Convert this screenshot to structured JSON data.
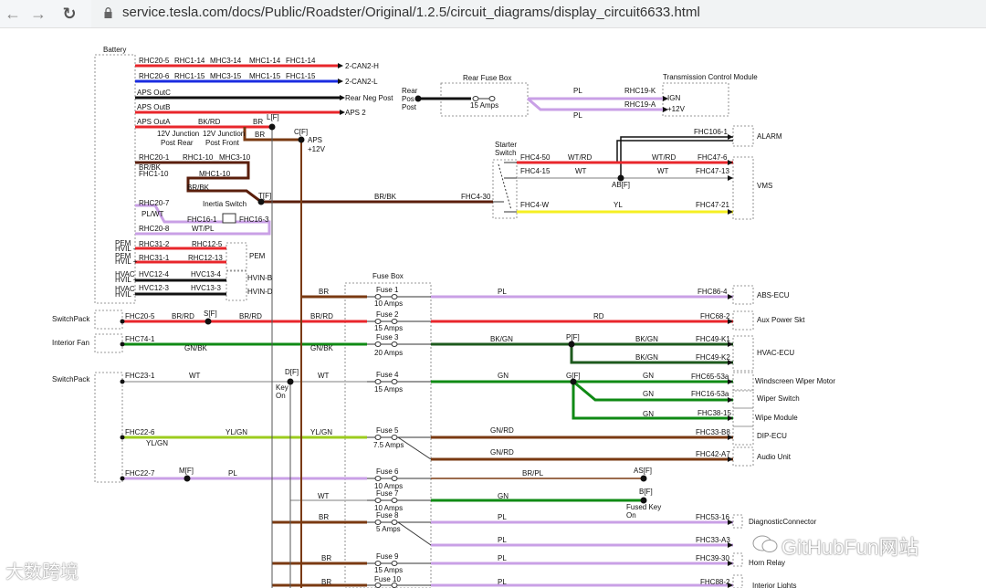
{
  "browser": {
    "back": "←",
    "forward": "→",
    "reload": "↻",
    "url": "service.tesla.com/docs/Public/Roadster/Original/1.2.5/circuit_diagrams/display_circuit6633.html"
  },
  "watermarks": {
    "left": "大数跨境",
    "right": "GitHubFun网站"
  },
  "colors": {
    "red": "#e8262b",
    "blue": "#1a2ce0",
    "black": "#111111",
    "brown": "#7a3a12",
    "purple": "#c9a0e6",
    "green": "#0f8a14",
    "dark_green": "#1d5a1d",
    "yellow_green": "#9ccc1e",
    "yellow": "#f5ef22",
    "gray": "#8a8a8a"
  },
  "labels": {
    "battery": "Battery",
    "rhc20_5": "RHC20-5",
    "rhc1_14": "RHC1-14",
    "mhc3_14": "MHC3-14",
    "mhc1_14": "MHC1-14",
    "fhc1_14": "FHC1-14",
    "can_h": "2-CAN2-H",
    "rhc20_6": "RHC20-6",
    "rhc1_15": "RHC1-15",
    "mhc3_15": "MHC3-15",
    "mhc1_15": "MHC1-15",
    "fhc1_15": "FHC1-15",
    "can_l": "2-CAN2-L",
    "aps_outc": "APS OutC",
    "rear_neg_post": "Rear Neg Post",
    "aps_outb": "APS OutB",
    "aps2": "APS 2",
    "aps_outa": "APS OutA",
    "bkrd": "BK/RD",
    "br": "BR",
    "lf": "L[F]",
    "j12v_rear": "12V Junction",
    "j12v_rear2": "Post Rear",
    "j12v_front": "12V Junction",
    "j12v_front2": "Post Front",
    "cf": "C[F]",
    "aps": "APS",
    "plus12v": "+12V",
    "rhc20_1": "RHC20-1",
    "rhc1_10": "RHC1-10",
    "mhc3_10": "MHC3-10",
    "brbk": "BR/BK",
    "fhc1_10": "FHC1-10",
    "mhc1_10": "MHC1-10",
    "tf": "T[F]",
    "fhc4_30": "FHC4-30",
    "rhc20_7": "RHC20-7",
    "inertia": "Inertia Switch",
    "plwt": "PL/WT",
    "fhc16_1": "FHC16-1",
    "fhc16_3": "FHC16-3",
    "rhc20_8": "RHC20-8",
    "wtpl": "WT/PL",
    "pem_hvil_m": "PEM\nHVIL -",
    "pem_hvil_p": "PEM\nHVIL +",
    "hvac_hvil_p": "HVAC\nHVIL +",
    "hvac_hvil_m": "HVAC\nHVIL -",
    "rhc31_2": "RHC31-2",
    "rhc12_5": "RHC12-5",
    "rhc31_1": "RHC31-1",
    "rhc12_13": "RHC12-13",
    "pem": "PEM",
    "hvc12_4": "HVC12-4",
    "hvc13_4": "HVC13-4",
    "hvin_b": "HVIN-B",
    "hvc12_3": "HVC12-3",
    "hvc13_3": "HVC13-3",
    "hvin_d": "HVIN-D",
    "rear_fuse_box": "Rear Fuse Box",
    "rear_pos_post": "Rear\nPos\nPost",
    "amps15": "15 Amps",
    "pl": "PL",
    "rhc19_k": "RHC19-K",
    "rhc19_a": "RHC19-A",
    "tcm": "Transmission Control Module",
    "ign": "IGN",
    "starter_switch": "Starter\nSwitch",
    "fhc106_1": "FHC106-1",
    "alarm": "ALARM",
    "fhc4_50": "FHC4-50",
    "wtrd": "WT/RD",
    "fhc47_6": "FHC47-6",
    "fhc4_15": "FHC4-15",
    "wt": "WT",
    "fhc47_13": "FHC47-13",
    "abf": "AB[F]",
    "vms": "VMS",
    "fhc4_w": "FHC4-W",
    "yl": "YL",
    "fhc47_21": "FHC47-21",
    "fuse_box": "Fuse Box",
    "fuse1": "Fuse 1",
    "amps10": "10 Amps",
    "fuse2": "Fuse 2",
    "fuse3": "Fuse 3",
    "amps20": "20 Amps",
    "fuse4": "Fuse 4",
    "fuse5": "Fuse 5",
    "amps7_5": "7.5 Amps",
    "fuse6": "Fuse 6",
    "fuse7": "Fuse 7",
    "fuse8": "Fuse 8",
    "amps5": "5 Amps",
    "fuse9": "Fuse 9",
    "fuse10": "Fuse 10",
    "fhc86_4": "FHC86-4",
    "abs_ecu": "ABS-ECU",
    "switchpack": "SwitchPack",
    "fhc20_5": "FHC20-5",
    "brrd": "BR/RD",
    "sf": "S[F]",
    "rd": "RD",
    "fhc68_2": "FHC68-2",
    "aux_power": "Aux Power Skt",
    "interior_fan": "Interior Fan",
    "fhc74_1": "FHC74-1",
    "gnbk": "GN/BK",
    "bkgn": "BK/GN",
    "pf": "P[F]",
    "fhc49_k1": "FHC49-K1",
    "fhc49_k2": "FHC49-K2",
    "hvac_ecu": "HVAC-ECU",
    "fhc23_1": "FHC23-1",
    "df": "D[F]",
    "key_on": "Key\nOn",
    "gn": "GN",
    "gf": "G[F]",
    "fhc65_53a": "FHC65-53a",
    "wiper_motor": "Windscreen Wiper Motor",
    "fhc16_53a": "FHC16-53a",
    "wiper_switch": "Wiper Switch",
    "fhc38_15": "FHC38-15",
    "wipe_module": "Wipe Module",
    "fhc22_6": "FHC22-6",
    "ylgn": "YL/GN",
    "gnrd": "GN/RD",
    "fhc33_b8": "FHC33-B8",
    "dip_ecu": "DIP-ECU",
    "fhc42_a7": "FHC42-A7",
    "audio_unit": "Audio Unit",
    "fhc22_7": "FHC22-7",
    "mf": "M[F]",
    "brpl": "BR/PL",
    "asf": "AS[F]",
    "bf": "B[F]",
    "fused_key_on": "Fused Key\nOn",
    "fhc53_16": "FHC53-16",
    "diag_conn": "DiagnosticConnector",
    "fhc33_a3": "FHC33-A3",
    "fhc39_30": "FHC39-30",
    "horn_relay": "Horn Relay",
    "fhc88_2": "FHC88-2",
    "interior_lights": "Interior Lights"
  }
}
